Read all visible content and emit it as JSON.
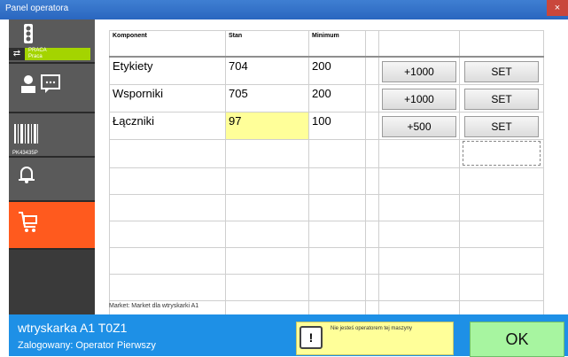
{
  "window": {
    "title": "Panel operatora",
    "close_label": "×"
  },
  "sidebar": {
    "status_label": "PRACA",
    "status_sub": "Praca",
    "barcode_code": "PK43435P",
    "icons": [
      "traffic-light-icon",
      "swap-arrows-icon",
      "operator-chat-icon",
      "barcode-icon",
      "alarm-bell-icon",
      "cart-icon",
      "gear-icon"
    ]
  },
  "table": {
    "headers": [
      "Komponent",
      "Stan",
      "Minimum",
      "",
      "",
      ""
    ],
    "rows": [
      {
        "komponent": "Etykiety",
        "stan": "704",
        "minimum": "200",
        "add": "+1000",
        "set": "SET",
        "low": false
      },
      {
        "komponent": "Wsporniki",
        "stan": "705",
        "minimum": "200",
        "add": "+1000",
        "set": "SET",
        "low": false
      },
      {
        "komponent": "Łączniki",
        "stan": "97",
        "minimum": "100",
        "add": "+500",
        "set": "SET",
        "low": true
      }
    ],
    "low_stock_color": "#ffff99"
  },
  "market_text": "Market: Market dla wtryskarki A1",
  "footer": {
    "machine": "wtryskarka A1   T0Z1",
    "user": "Zalogowany: Operator Pierwszy",
    "notice": "Nie jesteś operatorem tej maszyny",
    "ok_label": "OK"
  },
  "colors": {
    "accent_blue": "#1e90e6",
    "active_orange": "#ff5a1e",
    "status_green": "#a4d400",
    "ok_green": "#a7f5a0"
  }
}
